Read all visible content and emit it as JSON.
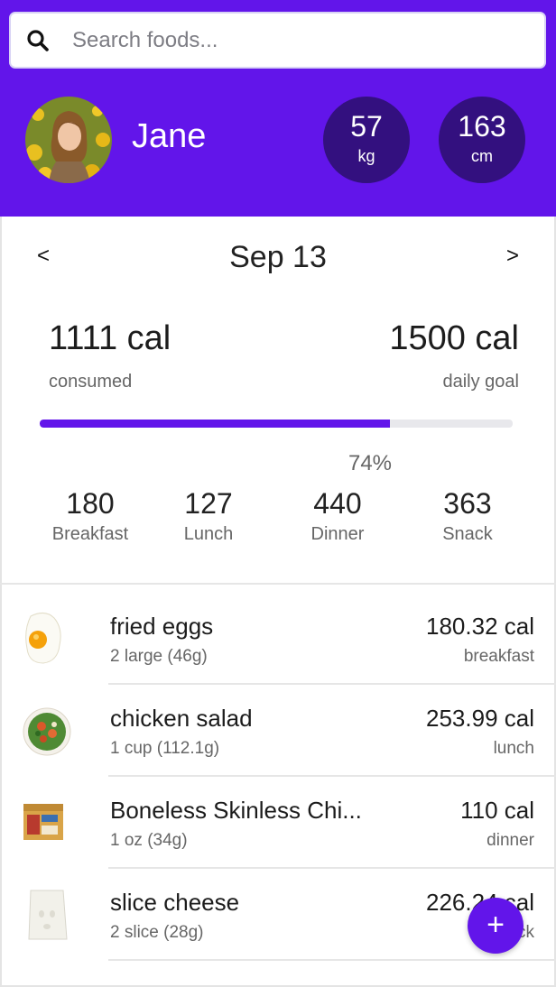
{
  "search": {
    "placeholder": "Search foods..."
  },
  "user": {
    "name": "Jane"
  },
  "stats": {
    "weight": {
      "value": "57",
      "unit": "kg"
    },
    "height": {
      "value": "163",
      "unit": "cm"
    }
  },
  "date_nav": {
    "prev": "<",
    "date": "Sep 13",
    "next": ">"
  },
  "calories": {
    "consumed_value": "1111 cal",
    "consumed_label": "consumed",
    "goal_value": "1500 cal",
    "goal_label": "daily goal",
    "progress_fraction": 0.74,
    "progress_label": "74%"
  },
  "meals": [
    {
      "value": "180",
      "label": "Breakfast"
    },
    {
      "value": "127",
      "label": "Lunch"
    },
    {
      "value": "440",
      "label": "Dinner"
    },
    {
      "value": "363",
      "label": "Snack"
    }
  ],
  "foods": [
    {
      "name": "fried eggs",
      "quantity": "2 large (46g)",
      "calories": "180.32 cal",
      "meal": "breakfast",
      "icon": "fried-egg-icon"
    },
    {
      "name": "chicken salad",
      "quantity": "1 cup (112.1g)",
      "calories": "253.99 cal",
      "meal": "lunch",
      "icon": "salad-icon"
    },
    {
      "name": "Boneless Skinless Chi...",
      "quantity": "1 oz (34g)",
      "calories": "110 cal",
      "meal": "dinner",
      "icon": "package-icon"
    },
    {
      "name": "slice cheese",
      "quantity": "2 slice (28g)",
      "calories": "226.24 cal",
      "meal": "snack",
      "icon": "cheese-icon"
    }
  ],
  "fab": {
    "label": "+"
  },
  "colors": {
    "accent": "#6215ea",
    "stat_circle": "#33107f"
  }
}
